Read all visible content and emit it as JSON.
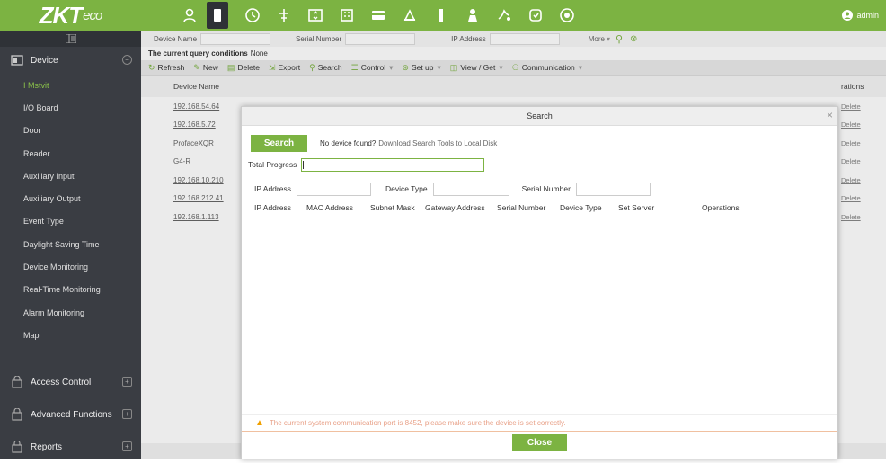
{
  "brand": {
    "logo_main": "ZKT",
    "logo_sub": "eco"
  },
  "header": {
    "user": "admin",
    "top_icons": [
      "personnel-icon",
      "device-icon",
      "time-attendance-icon",
      "access-icon",
      "elevator-icon",
      "building-icon",
      "consumption-icon",
      "parking-icon",
      "patrol-icon",
      "visitor-icon",
      "video-icon",
      "settings-icon",
      "help-icon"
    ]
  },
  "sidebar": {
    "device_group": "Device",
    "items": [
      "I Mstvit",
      "I/O Board",
      "Door",
      "Reader",
      "Auxiliary Input",
      "Auxiliary Output",
      "Event Type",
      "Daylight Saving Time",
      "Device Monitoring",
      "Real-Time Monitoring",
      "Alarm Monitoring",
      "Map"
    ],
    "groups_bottom": [
      "Access Control",
      "Advanced Functions",
      "Reports"
    ]
  },
  "filters": {
    "device_name": "Device Name",
    "serial_number": "Serial Number",
    "ip_address": "IP Address",
    "more": "More"
  },
  "conditions": {
    "label": "The current query conditions",
    "value": "None"
  },
  "toolbar": {
    "refresh": "Refresh",
    "new": "New",
    "delete": "Delete",
    "export": "Export",
    "search": "Search",
    "control": "Control",
    "setup": "Set up",
    "view_get": "View / Get",
    "communication": "Communication"
  },
  "table": {
    "col_device_name": "Device Name",
    "col_operations": "rations",
    "rows": [
      "192.168.54.64",
      "192.168.5.72",
      "ProfaceXQR",
      "G4-R",
      "192.168.10.210",
      "192.168.212.41",
      "192.168.1.113"
    ],
    "delete_label": "Delete"
  },
  "modal": {
    "title": "Search",
    "search_button": "Search",
    "no_device": "No device found?",
    "download_link": "Download Search Tools to Local Disk",
    "total_progress": "Total Progress",
    "progress_value": 0,
    "ip_label": "IP Address",
    "device_type_label": "Device Type",
    "serial_label": "Serial Number",
    "cols": [
      "IP Address",
      "MAC Address",
      "Subnet Mask",
      "Gateway Address",
      "Serial Number",
      "Device Type",
      "Set Server",
      "Operations"
    ],
    "warning": "The current system communication port is 8452, please make sure the device is set correctly.",
    "close_button": "Close"
  },
  "colors": {
    "accent": "#7cb342",
    "sidebar": "#3a3d43"
  }
}
